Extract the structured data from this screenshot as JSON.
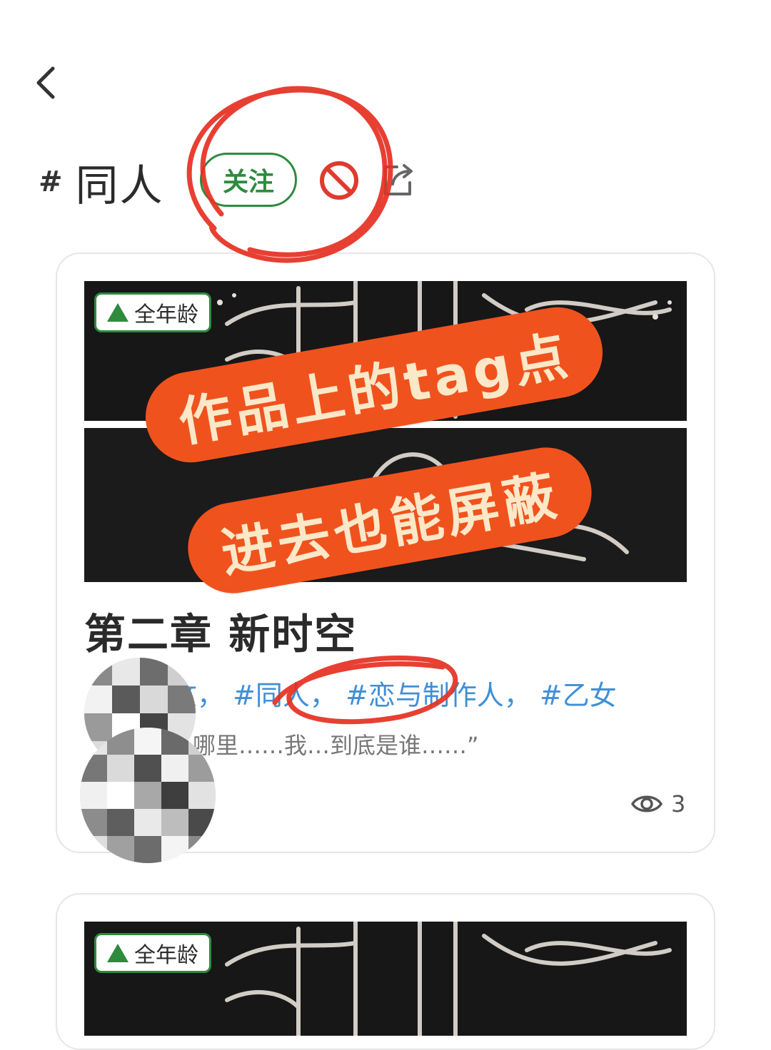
{
  "header": {
    "hash": "#",
    "tag_name": "同人",
    "follow_label": "关注"
  },
  "cards": [
    {
      "age_rating": "全年龄",
      "title": "第二章 新时空",
      "tags": [
        "#甜文，",
        "#同人，",
        "#恋与制作人，",
        "#乙女"
      ],
      "excerpt": "哪里……我…到底是谁……”",
      "views": "3"
    },
    {
      "age_rating": "全年龄"
    }
  ],
  "callout": {
    "line1": "作品上的tag点",
    "line2": "进去也能屏蔽"
  },
  "colors": {
    "accent_green": "#2e8b3e",
    "tag_blue": "#3f8fd8",
    "callout_orange": "#f0521e",
    "annotation_red": "#e53022"
  }
}
